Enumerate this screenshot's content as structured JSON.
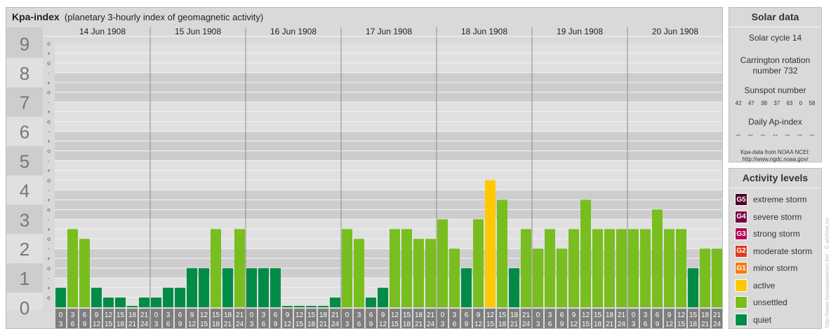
{
  "header": {
    "title": "Kpa-index",
    "subtitle": "(planetary 3-hourly index of geomagnetic activity)"
  },
  "chart_data": {
    "type": "bar",
    "title": "Kpa-index",
    "subtitle": "(planetary 3-hourly index of geomagnetic activity)",
    "ylim": [
      0,
      9
    ],
    "y_ticks": [
      "0",
      "1",
      "2",
      "3",
      "4",
      "5",
      "6",
      "7",
      "8",
      "9"
    ],
    "y_minor_marks": [
      "-",
      "o",
      "+"
    ],
    "days": [
      "14 Jun 1908",
      "15 Jun 1908",
      "16 Jun 1908",
      "17 Jun 1908",
      "18 Jun 1908",
      "19 Jun 1908",
      "20 Jun 1908"
    ],
    "interval_start": [
      "0",
      "3",
      "6",
      "9",
      "12",
      "15",
      "18",
      "21"
    ],
    "interval_end": [
      "3",
      "6",
      "9",
      "12",
      "15",
      "18",
      "21",
      "24"
    ],
    "values": [
      0.667,
      2.667,
      2.333,
      0.667,
      0.333,
      0.333,
      0.0,
      0.333,
      0.333,
      0.667,
      0.667,
      1.333,
      1.333,
      2.667,
      1.333,
      2.667,
      1.333,
      1.333,
      1.333,
      0.0,
      0.0,
      0.0,
      0.0,
      0.333,
      2.667,
      2.333,
      0.333,
      0.667,
      2.667,
      2.667,
      2.333,
      2.333,
      3.0,
      2.0,
      1.333,
      3.0,
      4.333,
      3.667,
      1.333,
      2.667,
      2.0,
      2.667,
      2.0,
      2.667,
      3.667,
      2.667,
      2.667,
      2.667,
      2.667,
      2.667,
      3.333,
      2.667,
      2.667,
      1.333,
      2.0,
      2.0
    ],
    "level_colors": {
      "quiet": "#008c46",
      "unsettled": "#78be1e",
      "active": "#ffc800",
      "G1": "#f57d0f",
      "G2": "#dc3c1e",
      "G3": "#b4005a",
      "G4": "#780046",
      "G5": "#500028"
    },
    "grid": true
  },
  "solar": {
    "title": "Solar data",
    "cycle": "Solar cycle 14",
    "carrington_line1": "Carrington rotation",
    "carrington_line2": "number 732",
    "sunspot_title": "Sunspot number",
    "sunspots": [
      "42",
      "47",
      "38",
      "37",
      "63",
      "0",
      "58"
    ],
    "ap_title": "Daily Ap-index",
    "ap_values": [
      "--",
      "--",
      "--",
      "--",
      "--",
      "--",
      "--"
    ],
    "source_line1": "Kpa-data from NOAA NCEI:",
    "source_line2": "http://www.ngdc.noaa.gov/"
  },
  "activity": {
    "title": "Activity levels",
    "items": [
      {
        "code": "G5",
        "label": "extreme storm",
        "color": "#500028"
      },
      {
        "code": "G4",
        "label": "severe storm",
        "color": "#780046"
      },
      {
        "code": "G3",
        "label": "strong storm",
        "color": "#b4005a"
      },
      {
        "code": "G2",
        "label": "moderate storm",
        "color": "#dc3c1e"
      },
      {
        "code": "G1",
        "label": "minor storm",
        "color": "#f57d0f"
      },
      {
        "code": "",
        "label": "active",
        "color": "#ffc800"
      },
      {
        "code": "",
        "label": "unsettled",
        "color": "#78be1e"
      },
      {
        "code": "",
        "label": "quiet",
        "color": "#008c46"
      }
    ]
  },
  "watermark": "http://www.tieosatalwezen.be/ ; © archive.oo"
}
